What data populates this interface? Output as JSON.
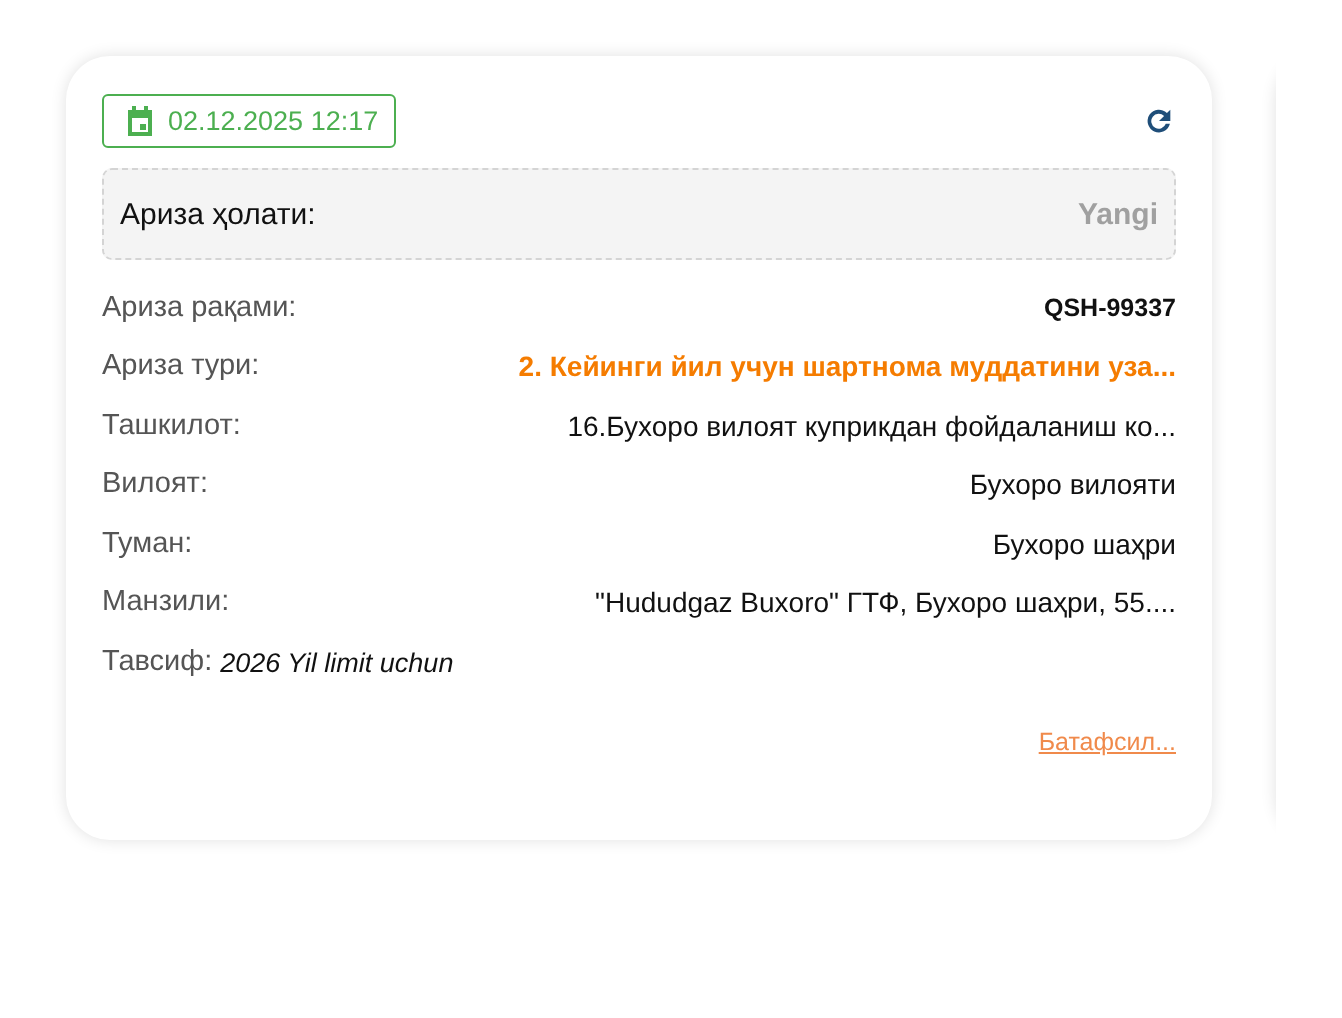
{
  "card": {
    "date": "02.12.2025 12:17",
    "status": {
      "label": "Ариза ҳолати:",
      "value": "Yangi"
    },
    "fields": [
      {
        "label": "Ариза рақами:",
        "value": "QSH-99337",
        "kind": "code"
      },
      {
        "label": "Ариза тури:",
        "value": "2. Кейинги йил учун шартнома муддатини уза...",
        "kind": "accent"
      },
      {
        "label": "Ташкилот:",
        "value": "16.Бухоро вилоят куприкдан фойдаланиш ко...",
        "kind": "plain"
      },
      {
        "label": "Вилоят:",
        "value": "Бухоро вилояти",
        "kind": "plain"
      },
      {
        "label": "Туман:",
        "value": "Бухоро шаҳри",
        "kind": "plain"
      },
      {
        "label": "Манзили:",
        "value": "\"Hududgaz Buxoro\" ГТФ, Бухоро шаҳри, 55....",
        "kind": "plain"
      }
    ],
    "description": {
      "label": "Тавсиф:",
      "value": "2026 Yil limit uchun"
    },
    "more_link": "Батафсил..."
  }
}
